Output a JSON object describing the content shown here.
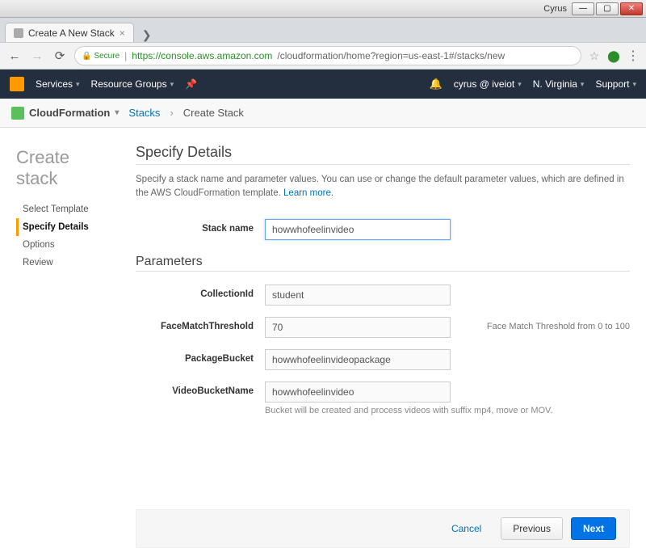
{
  "window": {
    "user_label": "Cyrus"
  },
  "browser": {
    "tab_title": "Create A New Stack",
    "secure_label": "Secure",
    "url_host": "https://console.aws.amazon.com",
    "url_path": "/cloudformation/home?region=us-east-1#/stacks/new"
  },
  "aws_nav": {
    "services": "Services",
    "resource_groups": "Resource Groups",
    "user": "cyrus @ iveiot",
    "region": "N. Virginia",
    "support": "Support"
  },
  "service_bar": {
    "service": "CloudFormation",
    "bc1": "Stacks",
    "bc2": "Create Stack"
  },
  "wizard": {
    "title": "Create stack",
    "steps": [
      "Select Template",
      "Specify Details",
      "Options",
      "Review"
    ],
    "active_index": 1
  },
  "section": {
    "heading": "Specify Details",
    "desc": "Specify a stack name and parameter values. You can use or change the default parameter values, which are defined in the AWS CloudFormation template.",
    "learn_more": "Learn more."
  },
  "form": {
    "stack_name_label": "Stack name",
    "stack_name_value": "howwhofeelinvideo",
    "parameters_heading": "Parameters",
    "fields": [
      {
        "label": "CollectionId",
        "value": "student",
        "hint": "",
        "side": ""
      },
      {
        "label": "FaceMatchThreshold",
        "value": "70",
        "hint": "",
        "side": "Face Match Threshold from 0 to 100"
      },
      {
        "label": "PackageBucket",
        "value": "howwhofeelinvideopackage",
        "hint": "",
        "side": ""
      },
      {
        "label": "VideoBucketName",
        "value": "howwhofeelinvideo",
        "hint": "Bucket will be created and process videos with suffix mp4, move or MOV.",
        "side": ""
      }
    ]
  },
  "footer": {
    "cancel": "Cancel",
    "previous": "Previous",
    "next": "Next"
  }
}
